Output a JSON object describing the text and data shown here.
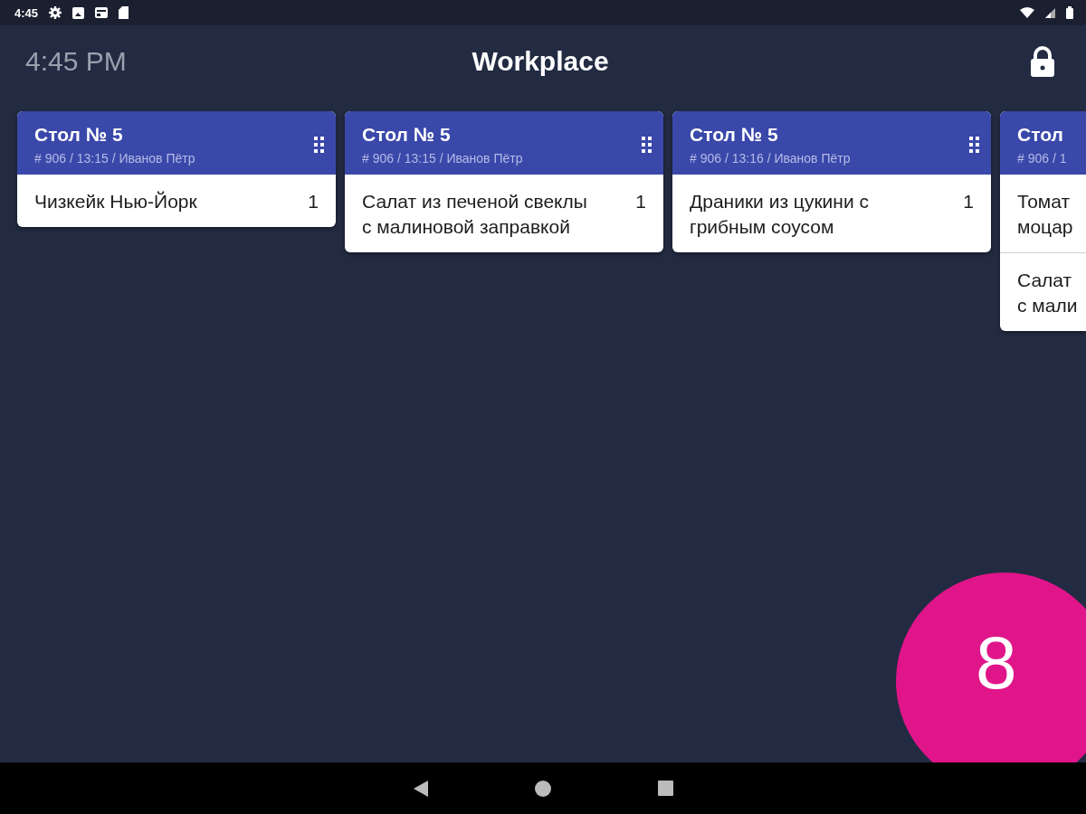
{
  "status_bar": {
    "time": "4:45"
  },
  "header": {
    "clock": "4:45 PM",
    "title": "Workplace"
  },
  "orders": [
    {
      "table": "Стол № 5",
      "meta": "# 906 / 13:15 / Иванов Пётр",
      "handle": true,
      "items": [
        {
          "name": "Чизкейк Нью-Йорк",
          "qty": "1"
        }
      ]
    },
    {
      "table": "Стол № 5",
      "meta": "# 906 / 13:15 / Иванов Пётр",
      "handle": true,
      "items": [
        {
          "name": "Салат из печеной свеклы с малиновой заправкой",
          "qty": "1"
        }
      ]
    },
    {
      "table": "Стол № 5",
      "meta": "# 906 / 13:16 / Иванов Пётр",
      "handle": true,
      "items": [
        {
          "name": "Драники из цукини с грибным соусом",
          "qty": "1"
        }
      ]
    },
    {
      "table": "Стол",
      "meta": "# 906 / 1",
      "handle": false,
      "items": [
        {
          "lines": [
            "Томат",
            "моцар"
          ]
        },
        {
          "lines": [
            "Салат",
            "с мали"
          ]
        }
      ]
    }
  ],
  "counter": "8"
}
